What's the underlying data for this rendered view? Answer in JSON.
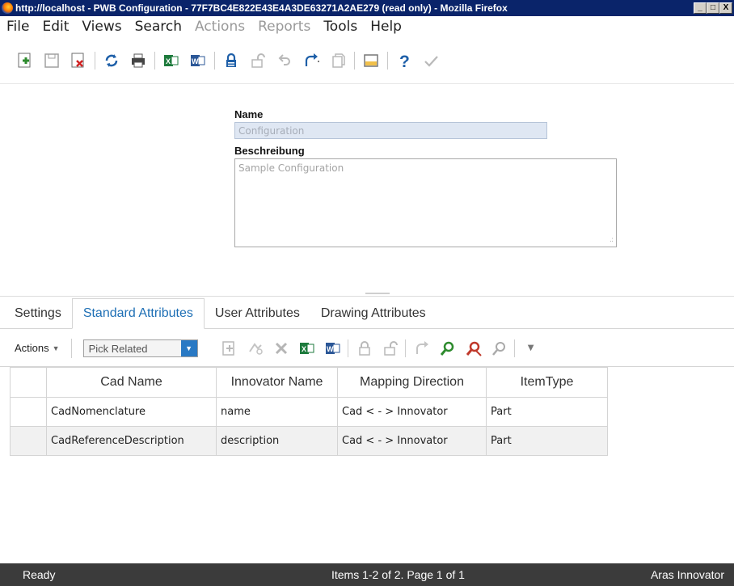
{
  "window": {
    "title": "http://localhost - PWB Configuration - 77F7BC4E822E43E4A3DE63271A2AE279 (read only) - Mozilla Firefox",
    "buttons": [
      "_",
      "□",
      "X"
    ]
  },
  "menu": [
    {
      "label": "File",
      "enabled": true
    },
    {
      "label": "Edit",
      "enabled": true
    },
    {
      "label": "Views",
      "enabled": true
    },
    {
      "label": "Search",
      "enabled": true
    },
    {
      "label": "Actions",
      "enabled": false
    },
    {
      "label": "Reports",
      "enabled": false
    },
    {
      "label": "Tools",
      "enabled": true
    },
    {
      "label": "Help",
      "enabled": true
    }
  ],
  "toolbar_icons": [
    "new-icon",
    "save-icon",
    "delete-icon",
    "refresh-icon",
    "print-icon",
    "excel-icon",
    "word-icon",
    "lock-icon",
    "unlock-icon",
    "undo-icon",
    "promote-icon",
    "copy-icon",
    "layout-icon",
    "help-icon",
    "check-icon"
  ],
  "form": {
    "name_label": "Name",
    "name_value": "Configuration",
    "desc_label": "Beschreibung",
    "desc_value": "Sample Configuration"
  },
  "tabs": [
    {
      "label": "Settings",
      "active": false
    },
    {
      "label": "Standard Attributes",
      "active": true
    },
    {
      "label": "User Attributes",
      "active": false
    },
    {
      "label": "Drawing Attributes",
      "active": false
    }
  ],
  "grid_toolbar": {
    "actions_label": "Actions",
    "pick_value": "Pick Related"
  },
  "table": {
    "columns": [
      "",
      "Cad Name",
      "Innovator Name",
      "Mapping Direction",
      "ItemType"
    ],
    "rows": [
      [
        "",
        "CadNomenclature",
        "name",
        "Cad < - > Innovator",
        "Part"
      ],
      [
        "",
        "CadReferenceDescription",
        "description",
        "Cad < - > Innovator",
        "Part"
      ]
    ]
  },
  "status": {
    "left": "Ready",
    "middle": "Items 1-2 of 2. Page 1 of 1",
    "right": "Aras Innovator"
  },
  "colors": {
    "title_bar": "#0a246a",
    "accent": "#1e6fb5",
    "status_bar": "#3b3b3b"
  }
}
